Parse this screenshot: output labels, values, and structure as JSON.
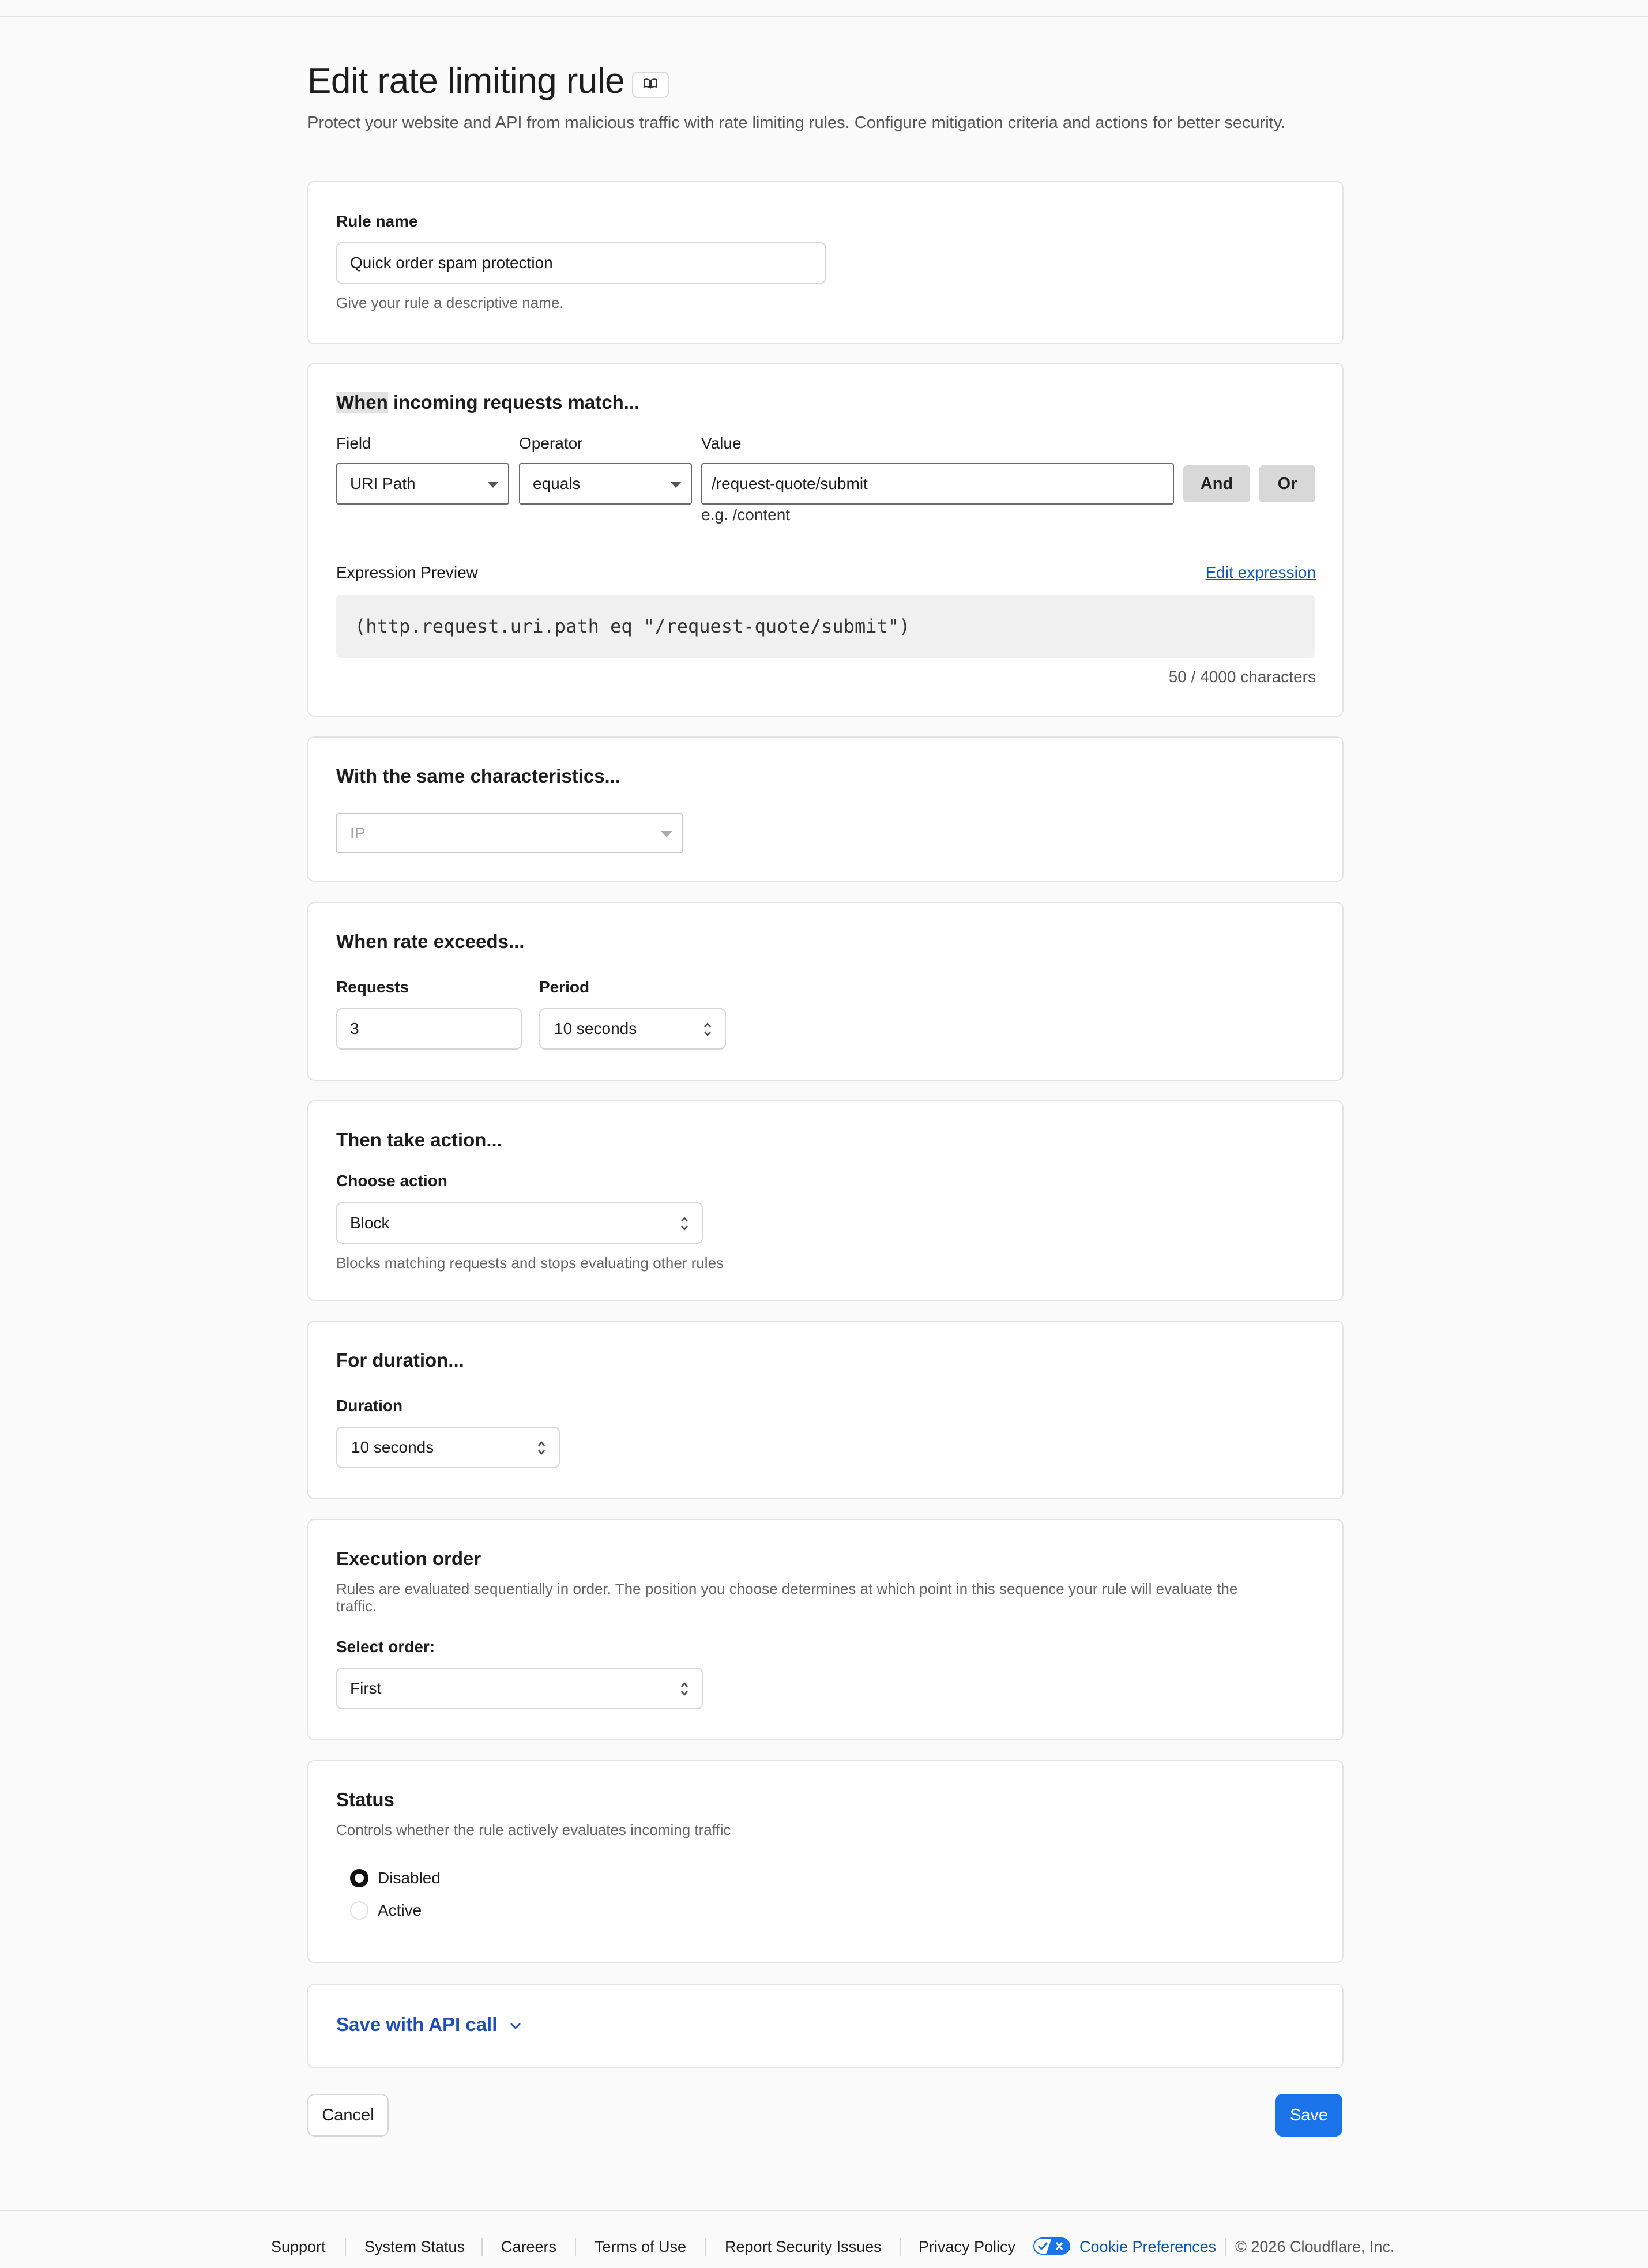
{
  "page": {
    "title": "Edit rate limiting rule",
    "subtitle": "Protect your website and API from malicious traffic with rate limiting rules. Configure mitigation criteria and actions for better security."
  },
  "rule_name": {
    "label": "Rule name",
    "value": "Quick order spam protection",
    "help": "Give your rule a descriptive name."
  },
  "match": {
    "title_highlight": "When",
    "title_rest": " incoming requests match...",
    "field_label": "Field",
    "operator_label": "Operator",
    "value_label": "Value",
    "field_value": "URI Path",
    "operator_value": "equals",
    "value_value": "/request-quote/submit",
    "value_hint": "e.g. /content",
    "and_label": "And",
    "or_label": "Or",
    "preview_label": "Expression Preview",
    "edit_expression": "Edit expression",
    "expression": "(http.request.uri.path eq \"/request-quote/submit\")",
    "char_count": "50 / 4000 characters"
  },
  "characteristics": {
    "title": "With the same characteristics...",
    "placeholder": "IP"
  },
  "rate": {
    "title": "When rate exceeds...",
    "requests_label": "Requests",
    "requests_value": "3",
    "period_label": "Period",
    "period_value": "10 seconds"
  },
  "action": {
    "title": "Then take action...",
    "label": "Choose action",
    "value": "Block",
    "help": "Blocks matching requests and stops evaluating other rules"
  },
  "duration": {
    "title": "For duration...",
    "label": "Duration",
    "value": "10 seconds"
  },
  "order": {
    "title": "Execution order",
    "desc_line1": "Rules are evaluated sequentially in order. The position you choose determines at which point in this sequence your rule will evaluate the",
    "desc_line2": "traffic.",
    "label": "Select order:",
    "value": "First"
  },
  "status": {
    "title": "Status",
    "desc": "Controls whether the rule actively evaluates incoming traffic",
    "options": [
      "Disabled",
      "Active"
    ],
    "selected": "Disabled"
  },
  "api": {
    "label": "Save with API call"
  },
  "buttons": {
    "cancel": "Cancel",
    "save": "Save"
  },
  "footer": {
    "links": [
      "Support",
      "System Status",
      "Careers",
      "Terms of Use",
      "Report Security Issues",
      "Privacy Policy"
    ],
    "cookie": "Cookie Preferences",
    "copyright": "© 2026 Cloudflare, Inc."
  },
  "colors": {
    "accent": "#1a73e8",
    "link": "#0b57b9",
    "api_link": "#1f4fb8"
  },
  "icons": [
    "book-icon",
    "dropdown-caret-icon",
    "updown-chevron-icon",
    "chevron-down-icon",
    "privacy-choices-icon"
  ]
}
